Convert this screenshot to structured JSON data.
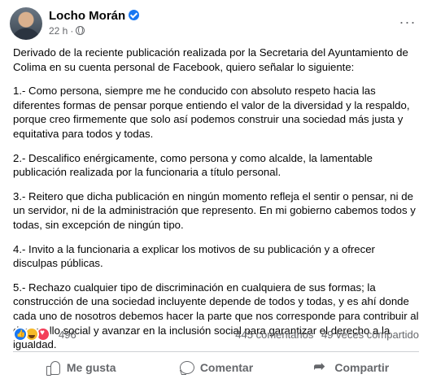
{
  "post": {
    "author": "Locho Morán",
    "time": "22 h",
    "separator": "·",
    "more_label": "···",
    "paragraphs": [
      "Derivado de la reciente publicación realizada por la Secretaria del Ayuntamiento de Colima en su cuenta personal de Facebook, quiero señalar lo siguiente:",
      "1.- Como persona, siempre me he conducido con absoluto respeto hacia las diferentes formas de pensar porque entiendo el valor de la diversidad y la respaldo, porque creo firmemente que solo así podemos construir una sociedad más justa y equitativa para todos y todas.",
      "2.- Descalifico enérgicamente, como persona y como alcalde, la lamentable publicación realizada por la funcionaria a título personal.",
      "3.- Reitero que dicha publicación en ningún momento refleja el sentir o pensar, ni de un servidor, ni de la administración que represento. En mi gobierno cabemos todos y todas, sin excepción de ningún tipo.",
      "4.- Invito a la funcionaria a explicar los motivos de su publicación y a ofrecer disculpas públicas.",
      "5.- Rechazo cualquier tipo de discriminación en cualquiera de sus formas; la construcción de una sociedad incluyente depende de todos y todas, y es ahí donde cada uno de nosotros debemos hacer la parte que nos corresponde para contribuir al desarrollo social y avanzar en la inclusión social para garantizar el derecho a la igualdad."
    ]
  },
  "stats": {
    "reaction_icons": [
      "like-icon",
      "haha-icon",
      "love-icon"
    ],
    "reaction_count": "496",
    "comments": "445 comentarios",
    "shares": "49 veces compartido"
  },
  "actions": {
    "like": "Me gusta",
    "comment": "Comentar",
    "share": "Compartir"
  },
  "colors": {
    "accent": "#1877f2",
    "secondary_text": "#65676b",
    "love": "#f33e58",
    "haha": "#f7b928"
  }
}
